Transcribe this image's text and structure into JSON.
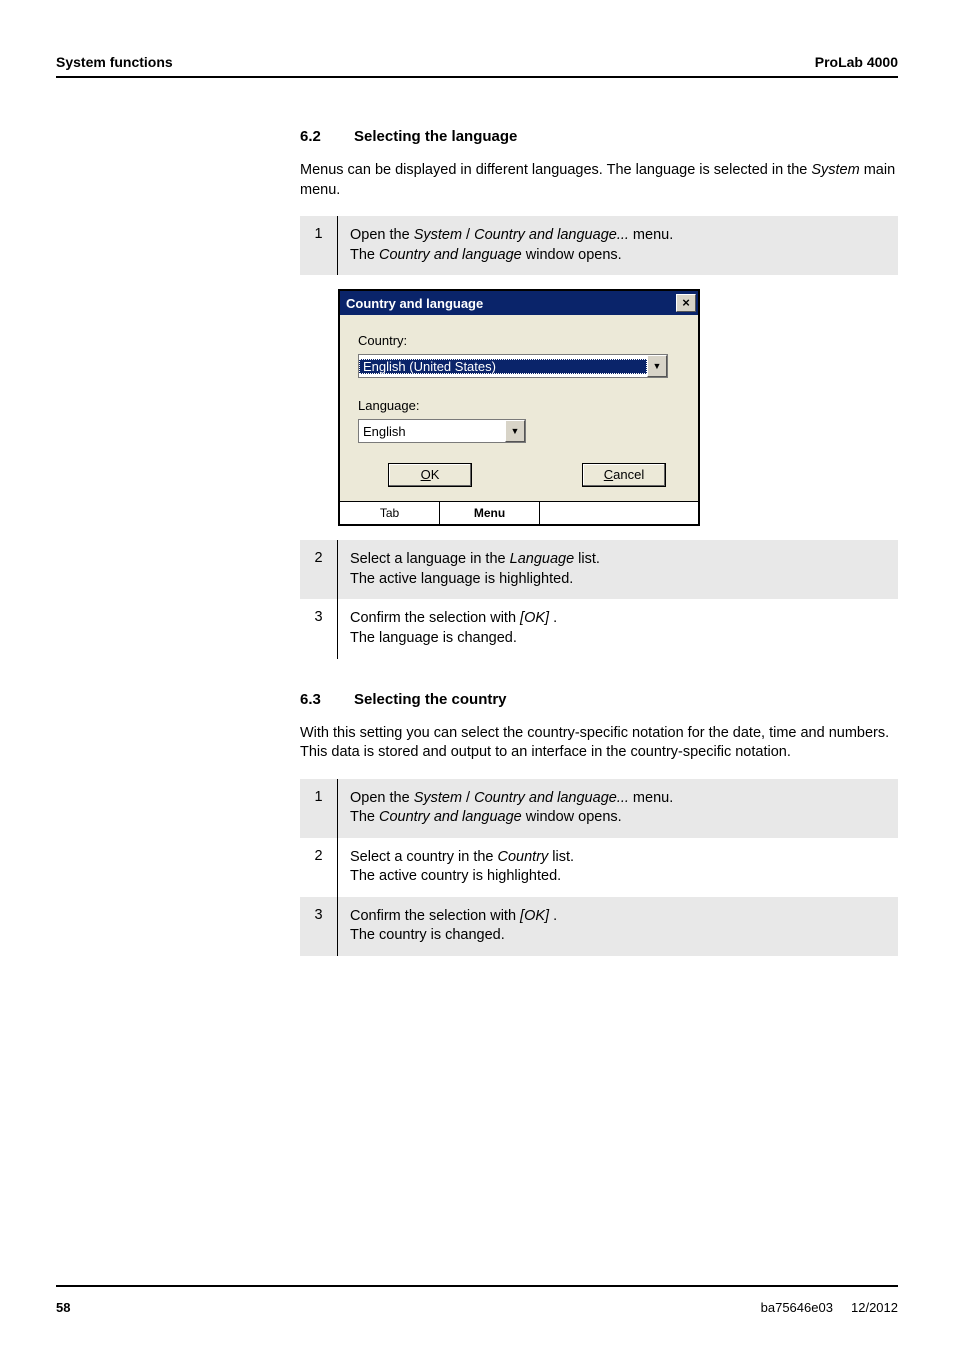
{
  "header": {
    "left": "System functions",
    "right": "ProLab 4000"
  },
  "section62": {
    "num": "6.2",
    "title": "Selecting the language",
    "intro_a": "Menus can be displayed in different languages. The language is selected in the ",
    "intro_b": "System",
    "intro_c": " main menu.",
    "steps": {
      "s1": {
        "n": "1",
        "a": "Open the ",
        "b": "System",
        "c": " / ",
        "d": "Country and language...",
        "e": " menu.\nThe ",
        "f": "Country and language",
        "g": " window opens."
      },
      "s2": {
        "n": "2",
        "a": "Select a language in the ",
        "b": "Language",
        "c": " list.\nThe active language is highlighted."
      },
      "s3": {
        "n": "3",
        "a": "Confirm the selection with ",
        "b": "[OK]",
        "c": " .\nThe language is changed."
      }
    }
  },
  "dialog": {
    "title": "Country and language",
    "close": "×",
    "country_label": "Country:",
    "country_value": "English (United States)",
    "language_label": "Language:",
    "language_value": "English",
    "ok_u": "O",
    "ok_rest": "K",
    "cancel_u": "C",
    "cancel_rest": "ancel",
    "tab": "Tab",
    "menu": "Menu"
  },
  "section63": {
    "num": "6.3",
    "title": "Selecting the country",
    "intro": "With this setting you can select the country-specific notation for the date, time and numbers. This data is stored and output to an interface in the country-specific notation.",
    "steps": {
      "s1": {
        "n": "1",
        "a": "Open the ",
        "b": "System",
        "c": " / ",
        "d": "Country and language...",
        "e": " menu.\nThe ",
        "f": "Country and language",
        "g": " window opens."
      },
      "s2": {
        "n": "2",
        "a": "Select a country in the ",
        "b": "Country",
        "c": " list.\nThe active country is highlighted."
      },
      "s3": {
        "n": "3",
        "a": "Confirm the selection with ",
        "b": "[OK]",
        "c": " .\nThe country is changed."
      }
    }
  },
  "footer": {
    "page": "58",
    "doc": "ba75646e03",
    "date": "12/2012"
  }
}
